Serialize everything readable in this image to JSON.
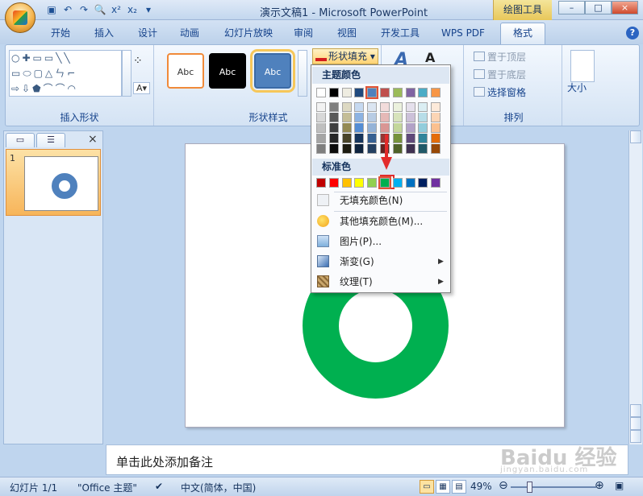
{
  "window": {
    "title": "演示文稿1 - Microsoft PowerPoint",
    "context_tab": "绘图工具",
    "controls": [
      "–",
      "□",
      "×"
    ]
  },
  "qat": {
    "icons": [
      "save-icon",
      "undo-icon",
      "redo-icon",
      "print-preview-icon",
      "superscript-icon",
      "subscript-icon",
      "customize-icon"
    ],
    "glyphs": [
      "▣",
      "↶",
      "↷",
      "🔍",
      "x²",
      "x₂",
      "▾"
    ]
  },
  "tabs": [
    {
      "label": "开始"
    },
    {
      "label": "插入"
    },
    {
      "label": "设计"
    },
    {
      "label": "动画"
    },
    {
      "label": "幻灯片放映"
    },
    {
      "label": "审阅"
    },
    {
      "label": "视图"
    },
    {
      "label": "开发工具"
    },
    {
      "label": "WPS PDF"
    },
    {
      "label": "格式",
      "active": true
    }
  ],
  "help_label": "?",
  "ribbon": {
    "insert_shapes": {
      "label": "插入形状",
      "rows": [
        "○✚▭▭╲╲",
        "▭⬭▢△ㄣ⌐",
        "⇨⇩⬟⌒⌒◠"
      ]
    },
    "shape_styles": {
      "label": "形状样式",
      "samples": [
        "Abc",
        "Abc",
        "Abc"
      ],
      "fill_button": "形状填充"
    },
    "arrange": {
      "label": "排列",
      "items": [
        "置于顶层",
        "置于底层",
        "选择窗格"
      ]
    },
    "size": {
      "label": "大小"
    }
  },
  "fill_menu": {
    "theme_header": "主题颜色",
    "standard_header": "标准色",
    "theme_top": [
      "#ffffff",
      "#000000",
      "#eeece1",
      "#1f497d",
      "#4f81bd",
      "#c0504d",
      "#9bbb59",
      "#8064a2",
      "#4bacc6",
      "#f79646"
    ],
    "theme_columns": [
      [
        "#f2f2f2",
        "#d8d8d8",
        "#bfbfbf",
        "#a5a5a5",
        "#7f7f7f"
      ],
      [
        "#7f7f7f",
        "#595959",
        "#3f3f3f",
        "#262626",
        "#0c0c0c"
      ],
      [
        "#ddd9c3",
        "#c4bd97",
        "#938953",
        "#494429",
        "#1d1b10"
      ],
      [
        "#c6d9f0",
        "#8db3e2",
        "#548dd4",
        "#17365d",
        "#0f243e"
      ],
      [
        "#dbe5f1",
        "#b8cce4",
        "#95b3d7",
        "#366092",
        "#244061"
      ],
      [
        "#f2dcdb",
        "#e5b9b7",
        "#d99694",
        "#953734",
        "#632423"
      ],
      [
        "#ebf1dd",
        "#d7e3bc",
        "#c3d69b",
        "#76923c",
        "#4f6128"
      ],
      [
        "#e5e0ec",
        "#ccc1d9",
        "#b2a2c7",
        "#5f497a",
        "#3f3151"
      ],
      [
        "#dbeef3",
        "#b7dde8",
        "#92cddc",
        "#31859b",
        "#205867"
      ],
      [
        "#fdeada",
        "#fbd5b5",
        "#fac08f",
        "#e36c09",
        "#974806"
      ]
    ],
    "standard": [
      "#c00000",
      "#ff0000",
      "#ffc000",
      "#ffff00",
      "#92d050",
      "#00b050",
      "#00b0f0",
      "#0070c0",
      "#002060",
      "#7030a0"
    ],
    "selected_standard": "#00b050",
    "items": [
      {
        "label": "无填充颜色(N)",
        "icon": "no-fill-icon",
        "submenu": false
      },
      {
        "label": "其他填充颜色(M)...",
        "icon": "palette-icon",
        "submenu": false
      },
      {
        "label": "图片(P)...",
        "icon": "picture-icon",
        "submenu": false
      },
      {
        "label": "渐变(G)",
        "icon": "gradient-icon",
        "submenu": true
      },
      {
        "label": "纹理(T)",
        "icon": "texture-icon",
        "submenu": true
      }
    ]
  },
  "slides_pane": {
    "tab_icons": [
      "slides-tab-icon",
      "outline-tab-icon"
    ],
    "close": "×",
    "thumb_number": "1"
  },
  "slide": {
    "shape": "donut",
    "fill_color": "#00b050"
  },
  "notes_placeholder": "单击此处添加备注",
  "status": {
    "slide": "幻灯片 1/1",
    "theme": "\"Office 主题\"",
    "language": "中文(简体，中国)",
    "zoom": "49%"
  },
  "watermark": {
    "main": "Baidu 经验",
    "sub": "jingyan.baidu.com"
  }
}
